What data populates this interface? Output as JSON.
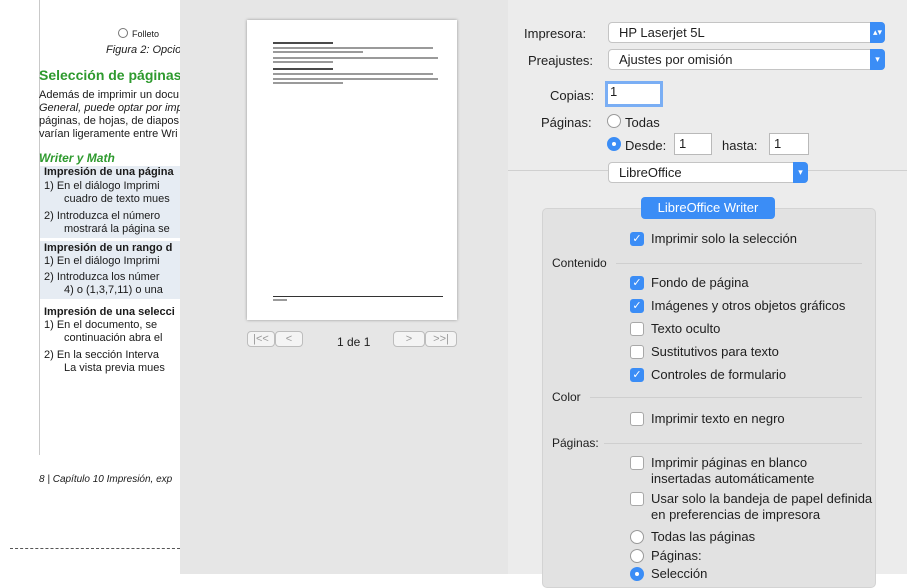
{
  "document": {
    "folleto": "Folleto",
    "caption": "Figura 2: Opcio",
    "heading": "Selección de páginas",
    "para": [
      "Además de imprimir un docu",
      "General, puede optar por imp",
      "páginas, de hojas, de diapos",
      "varían ligeramente entre Wri"
    ],
    "subheading": "Writer y Math",
    "s1_title": "Impresión de una página",
    "s1_items": [
      "1)  En el diálogo Imprimi",
      "cuadro de texto mues",
      "2)  Introduzca el número",
      "mostrará la página se"
    ],
    "s2_title": "Impresión de un rango d",
    "s2_items": [
      "1)  En el diálogo Imprimi",
      "2)  Introduzca los númer",
      "4) o (1,3,7,11) o una"
    ],
    "s3_title": "Impresión de una selecci",
    "s3_items": [
      "1)  En el documento, se",
      "continuación abra el",
      "2)  En la sección Interva",
      "La vista previa mues"
    ],
    "footer": "8 | Capítulo 10 Impresión, exp"
  },
  "preview": {
    "pager_text": "1 de 1",
    "first_label": "|<<",
    "prev_label": "<",
    "next_label": ">",
    "last_label": ">>|"
  },
  "form": {
    "printer_label": "Impresora:",
    "printer_value": "HP Laserjet 5L",
    "presets_label": "Preajustes:",
    "presets_value": "Ajustes por omisión",
    "copies_label": "Copias:",
    "copies_value": "1",
    "pages_label": "Páginas:",
    "all_label": "Todas",
    "from_label": "Desde:",
    "from_value": "1",
    "to_label": "hasta:",
    "to_value": "1",
    "app_popup": "LibreOffice"
  },
  "options": {
    "tab_label": "LibreOffice Writer",
    "print_selection_only": "Imprimir solo la selección",
    "contenido_label": "Contenido",
    "page_background": "Fondo de página",
    "images": "Imágenes y otros objetos gráficos",
    "hidden_text": "Texto oculto",
    "text_placeholders": "Sustitutivos para texto",
    "form_controls": "Controles de formulario",
    "color_label": "Color",
    "print_black": "Imprimir texto en negro",
    "paginas_label": "Páginas:",
    "blank_pages_1": "Imprimir páginas en blanco",
    "blank_pages_2": "insertadas automáticamente",
    "paper_tray_1": "Usar solo la bandeja de papel definida",
    "paper_tray_2": "en preferencias de impresora",
    "all_pages": "Todas las páginas",
    "pages": "Páginas:",
    "selection": "Selección"
  },
  "colors": {
    "accent": "#3b8df6",
    "green_heading": "#2e9a2e"
  }
}
